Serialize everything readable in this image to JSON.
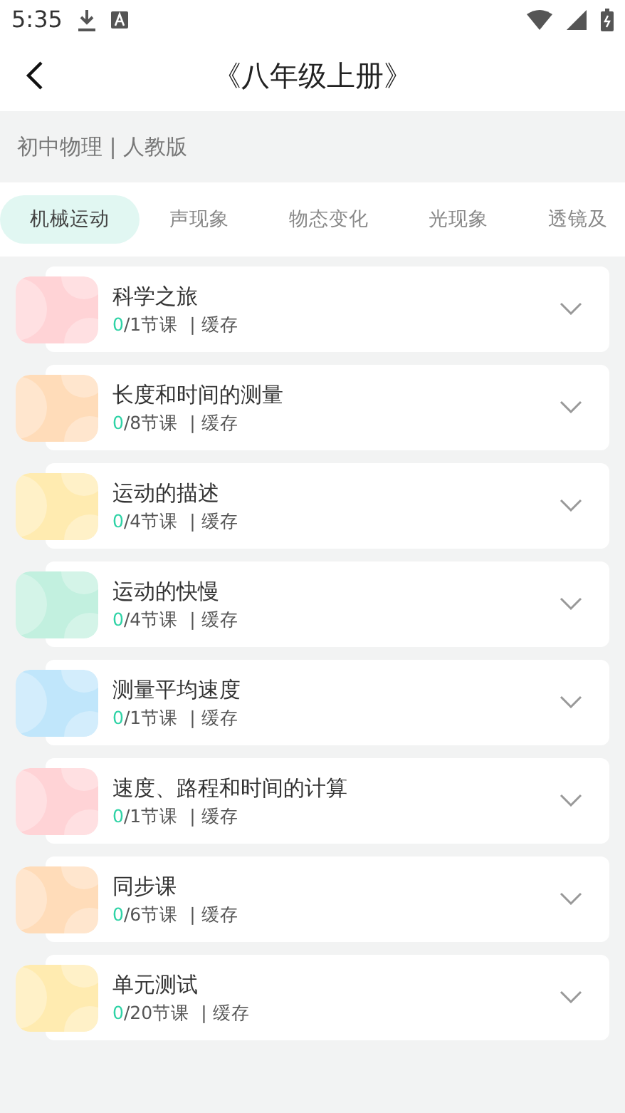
{
  "status_bar": {
    "time": "5:35"
  },
  "header": {
    "title": "《八年级上册》"
  },
  "subject": "初中物理 | 人教版",
  "tabs": [
    {
      "label": "机械运动",
      "selected": true
    },
    {
      "label": "声现象",
      "selected": false
    },
    {
      "label": "物态变化",
      "selected": false
    },
    {
      "label": "光现象",
      "selected": false
    },
    {
      "label": "透镜及",
      "selected": false
    }
  ],
  "chapters": [
    {
      "title": "科学之旅",
      "done": "0",
      "total": "/1节课",
      "cache": "| 缓存",
      "color": "#ffd3d6"
    },
    {
      "title": "长度和时间的测量",
      "done": "0",
      "total": "/8节课",
      "cache": "| 缓存",
      "color": "#ffdcb9"
    },
    {
      "title": "运动的描述",
      "done": "0",
      "total": "/4节课",
      "cache": "| 缓存",
      "color": "#ffebb0"
    },
    {
      "title": "运动的快慢",
      "done": "0",
      "total": "/4节课",
      "cache": "| 缓存",
      "color": "#c2f0df"
    },
    {
      "title": "测量平均速度",
      "done": "0",
      "total": "/1节课",
      "cache": "| 缓存",
      "color": "#c0e6fb"
    },
    {
      "title": "速度、路程和时间的计算",
      "done": "0",
      "total": "/1节课",
      "cache": "| 缓存",
      "color": "#ffd3d6"
    },
    {
      "title": "同步课",
      "done": "0",
      "total": "/6节课",
      "cache": "| 缓存",
      "color": "#ffdcb9"
    },
    {
      "title": "单元测试",
      "done": "0",
      "total": "/20节课",
      "cache": "| 缓存",
      "color": "#ffebb0"
    }
  ]
}
